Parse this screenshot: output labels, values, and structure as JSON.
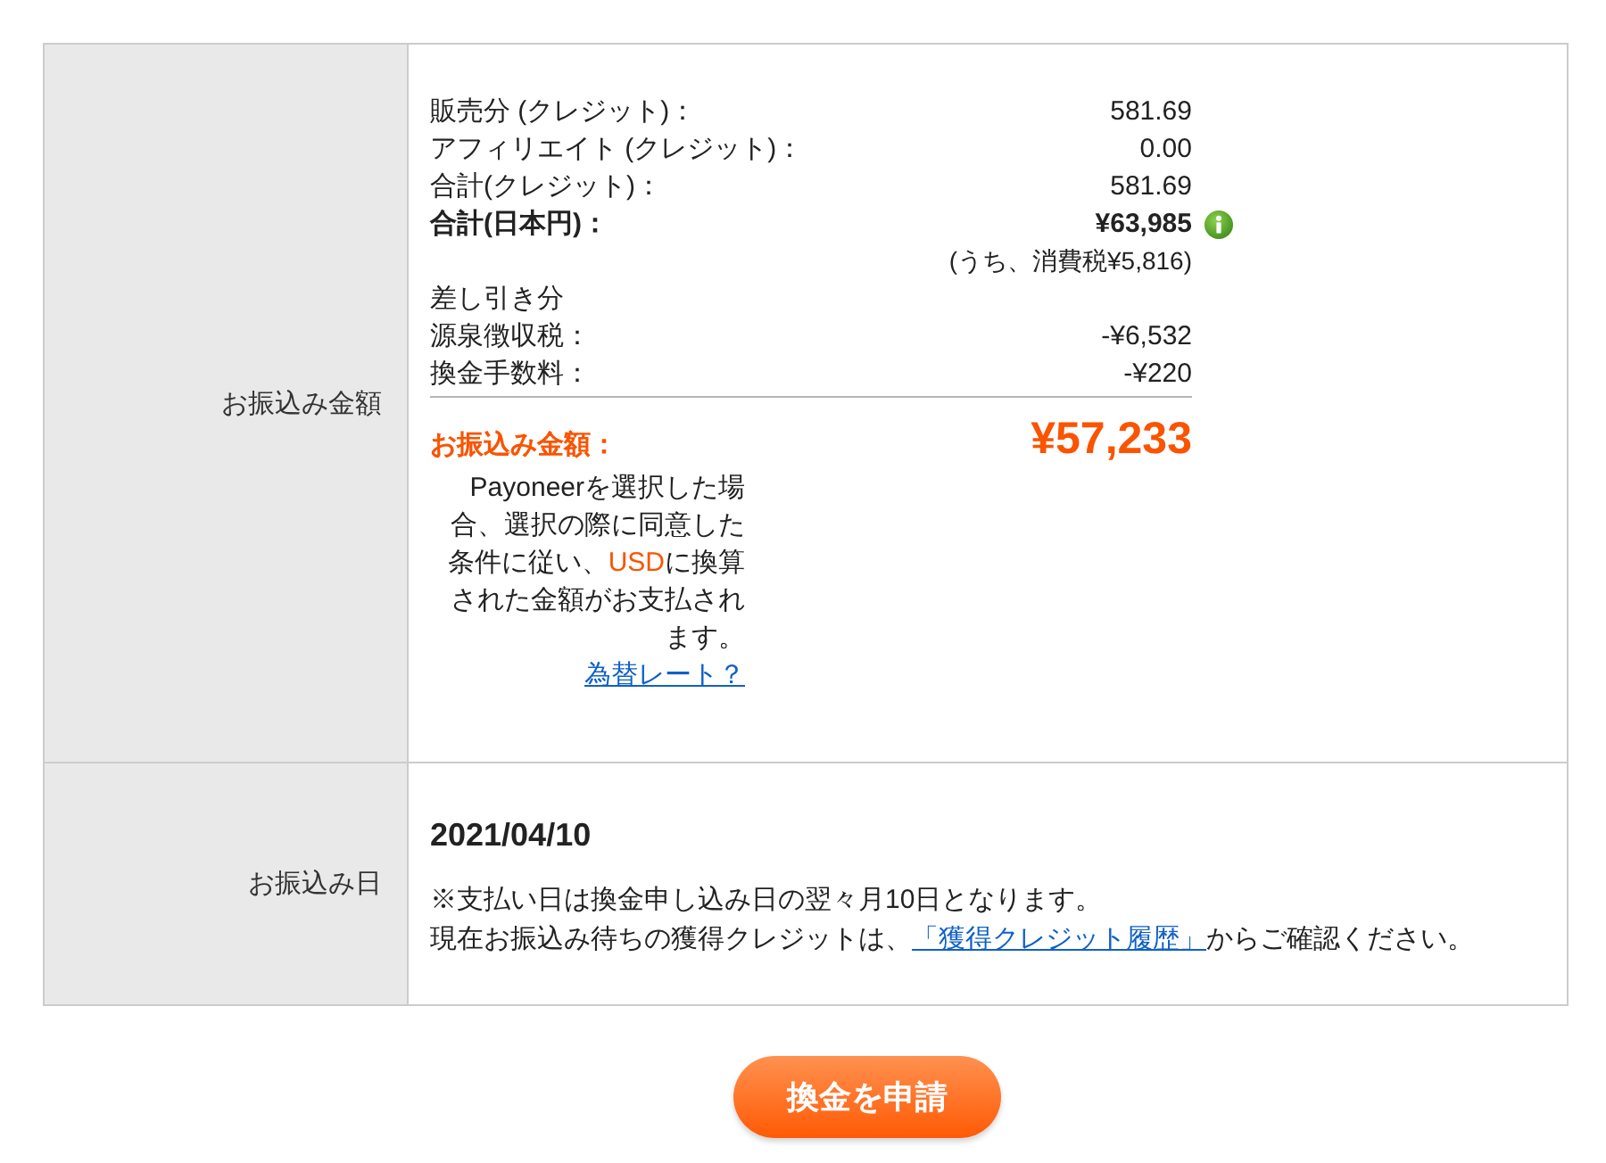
{
  "table": {
    "rows": [
      {
        "kind": "amount",
        "label": "お振込み金額",
        "lines": [
          {
            "kind": "item",
            "label": "販売分 (クレジット)：",
            "value": "581.69"
          },
          {
            "kind": "item",
            "label": "アフィリエイト (クレジット)：",
            "value": "0.00"
          },
          {
            "kind": "item",
            "label": "合計(クレジット)：",
            "value": "581.69"
          },
          {
            "kind": "bold",
            "label": "合計(日本円)：",
            "value": "¥63,985",
            "info": true
          },
          {
            "kind": "note",
            "value": "(うち、消費税¥5,816)"
          },
          {
            "kind": "heading",
            "label": "差し引き分"
          },
          {
            "kind": "item",
            "label": "源泉徴収税：",
            "value": "-¥6,532"
          },
          {
            "kind": "item",
            "label": "換金手数料：",
            "value": "-¥220"
          }
        ],
        "total": {
          "label": "お振込み金額：",
          "value": "¥57,233"
        },
        "notice": {
          "segments": [
            {
              "kind": "plain",
              "text": "Payoneerを選択した場合、選択の際に同意した条件に従い、"
            },
            {
              "kind": "highlight",
              "text": "USD"
            },
            {
              "kind": "plain",
              "text": "に換算された金額がお支払されます。"
            }
          ],
          "link": "為替レート？"
        }
      },
      {
        "kind": "date",
        "label": "お振込み日",
        "date": "2021/04/10",
        "note": "※支払い日は換金申し込み日の翌々月10日となります。",
        "history": {
          "before": "現在お振込み待ちの獲得クレジットは、",
          "link": "「獲得クレジット履歴」",
          "after": "からご確認ください。"
        }
      }
    ]
  },
  "submit_button": "換金を申請"
}
